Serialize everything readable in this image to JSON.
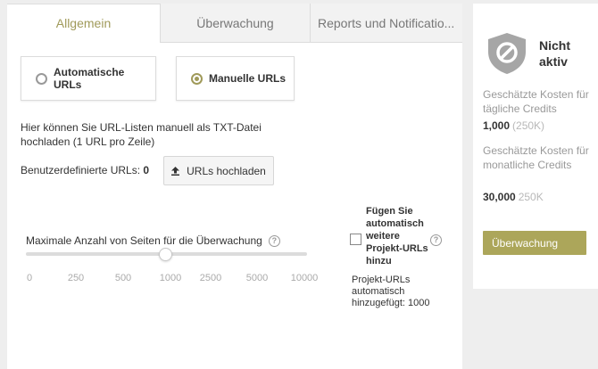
{
  "tabs": [
    {
      "label": "Allgemein"
    },
    {
      "label": "Überwachung"
    },
    {
      "label": "Reports und Notificatio..."
    }
  ],
  "url_mode": {
    "auto_label": "Automatische URLs",
    "manual_label": "Manuelle URLs",
    "selected": "manual"
  },
  "upload": {
    "help_text": "Hier können Sie URL-Listen manuell als TXT-Datei hochladen (1 URL pro Zeile)",
    "custom_label": "Benutzerdefinierte URLs:",
    "custom_count": "0",
    "button_label": "URLs hochladen",
    "button_icon": "upload-icon"
  },
  "max_pages": {
    "label": "Maximale Anzahl von Seiten für die Überwachung",
    "value": 1000,
    "ticks": [
      "0",
      "250",
      "500",
      "1000",
      "2500",
      "5000",
      "10000"
    ]
  },
  "auto_add": {
    "checked": false,
    "label": "Fügen Sie automatisch weitere Projekt-URLs hinzu",
    "added_text": "Projekt-URLs automatisch hinzugefügt: 1000"
  },
  "status": {
    "title": "Nicht aktiv",
    "icon": "shield-blocked-icon",
    "daily_label": "Geschätzte Kosten für tägliche Credits",
    "daily_value": "1,000",
    "daily_extra": "(250K)",
    "monthly_label": "Geschätzte Kosten für monatliche Credits",
    "monthly_value": "30,000",
    "monthly_extra": "250K",
    "button_label": "Überwachung"
  },
  "colors": {
    "accent": "#a09a5a",
    "button": "#aca65a"
  }
}
